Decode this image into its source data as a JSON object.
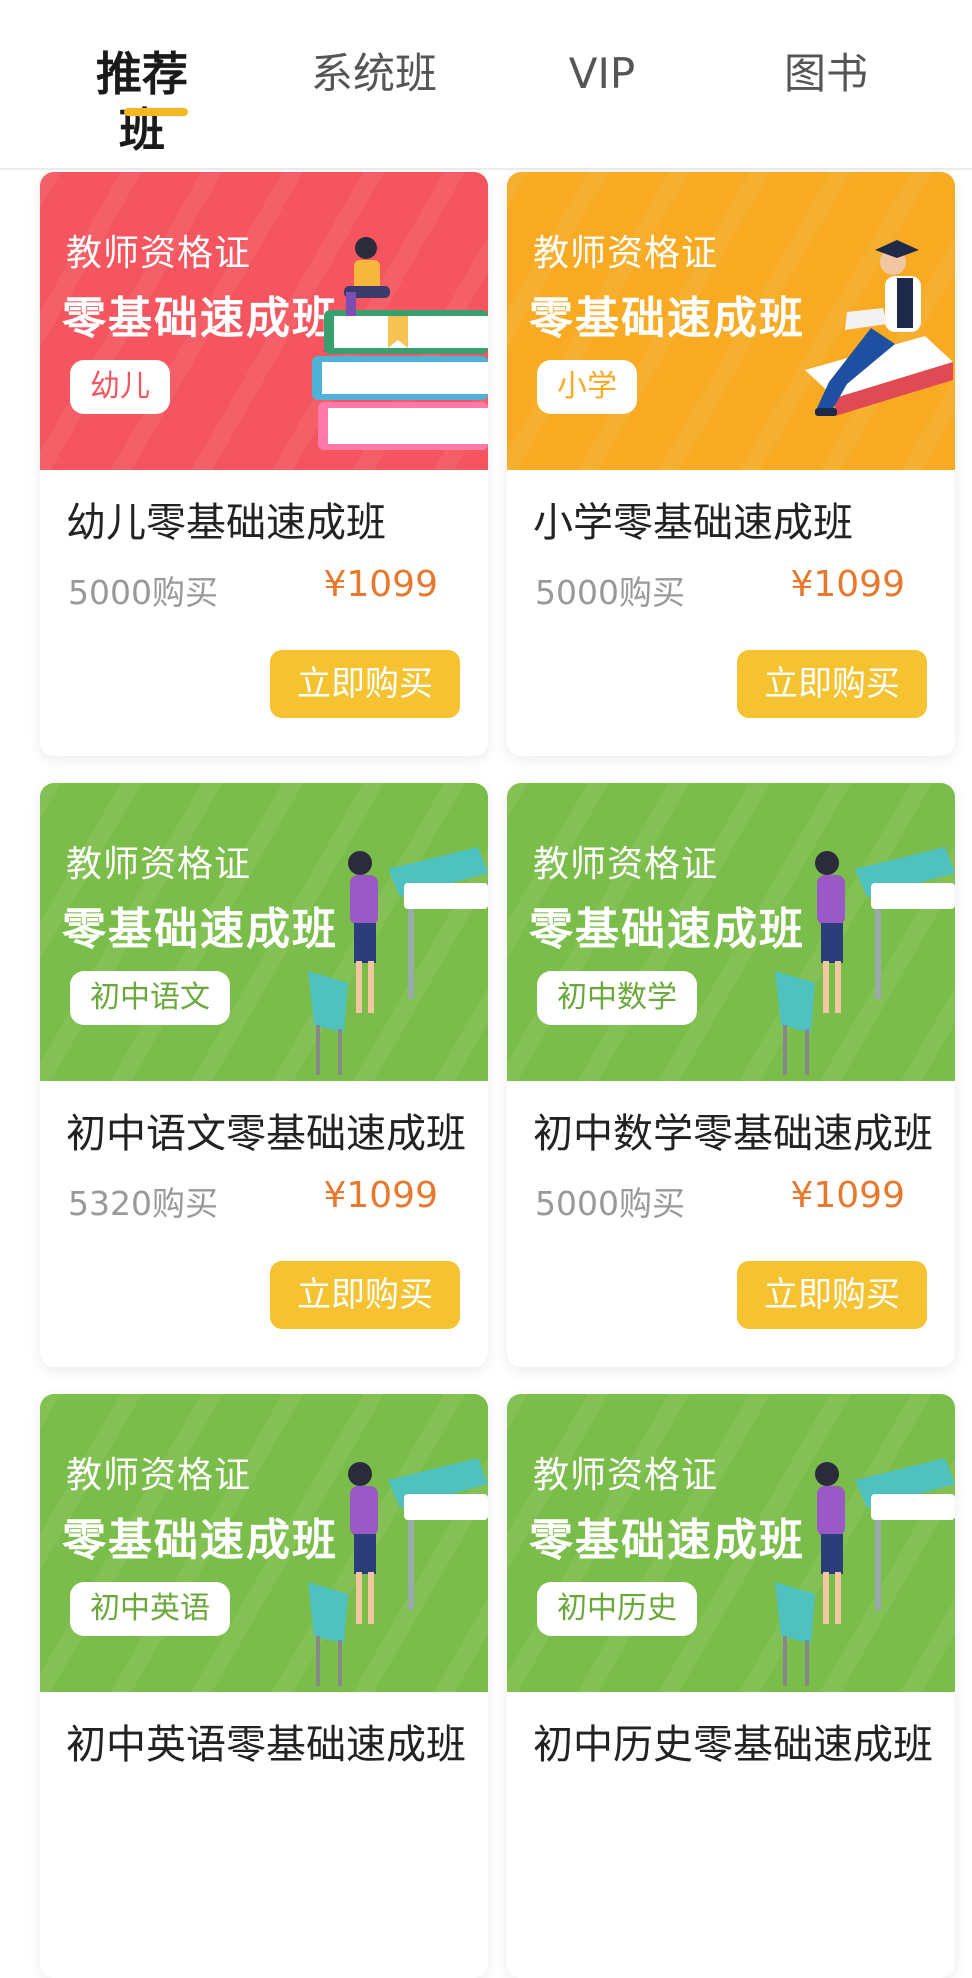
{
  "tabs": [
    {
      "label": "推荐班",
      "active": true
    },
    {
      "label": "系统班",
      "active": false
    },
    {
      "label": "VIP",
      "active": false
    },
    {
      "label": "图书",
      "active": false
    }
  ],
  "colors": {
    "accent": "#f5b623",
    "price": "#e8782c",
    "button": "#f5c332",
    "banner_red": "#f4555f",
    "banner_orange": "#f7aa22",
    "banner_green": "#7bbd4a"
  },
  "courses": [
    {
      "banner_sub": "教师资格证",
      "banner_title": "零基础速成班",
      "tag": "幼儿",
      "title": "幼儿零基础速成班",
      "sales": "5000购买",
      "price": "¥1099",
      "button": "立即购买",
      "illustration": "books-girl-icon"
    },
    {
      "banner_sub": "教师资格证",
      "banner_title": "零基础速成班",
      "tag": "小学",
      "title": "小学零基础速成班",
      "sales": "5000购买",
      "price": "¥1099",
      "button": "立即购买",
      "illustration": "graduate-reading-icon"
    },
    {
      "banner_sub": "教师资格证",
      "banner_title": "零基础速成班",
      "tag": "初中语文",
      "title": "初中语文零基础速成班",
      "sales": "5320购买",
      "price": "¥1099",
      "button": "立即购买",
      "illustration": "teacher-desk-icon"
    },
    {
      "banner_sub": "教师资格证",
      "banner_title": "零基础速成班",
      "tag": "初中数学",
      "title": "初中数学零基础速成班",
      "sales": "5000购买",
      "price": "¥1099",
      "button": "立即购买",
      "illustration": "teacher-desk-icon"
    },
    {
      "banner_sub": "教师资格证",
      "banner_title": "零基础速成班",
      "tag": "初中英语",
      "title": "初中英语零基础速成班",
      "sales": "",
      "price": "",
      "button": "",
      "illustration": "teacher-desk-icon"
    },
    {
      "banner_sub": "教师资格证",
      "banner_title": "零基础速成班",
      "tag": "初中历史",
      "title": "初中历史零基础速成班",
      "sales": "",
      "price": "",
      "button": "",
      "illustration": "teacher-desk-icon"
    }
  ]
}
